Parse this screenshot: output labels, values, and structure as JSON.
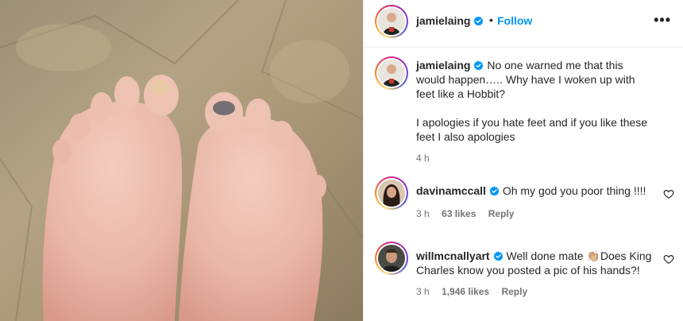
{
  "post": {
    "author": "jamielaing",
    "follow_label": "Follow",
    "separator": "•",
    "more_label": "•••"
  },
  "caption": {
    "author": "jamielaing",
    "line1": "No one warned me that this would happen….. Why have I woken up with feet like a Hobbit?",
    "line2": "I apologies if you hate feet and if you like these feet I also apologies",
    "time": "4 h"
  },
  "comments": [
    {
      "author": "davinamccall",
      "text": "Oh my god you poor thing !!!!",
      "time": "3 h",
      "likes": "63 likes",
      "reply_label": "Reply"
    },
    {
      "author": "willmcnallyart",
      "text_before": "Well done mate ",
      "emoji": "👏🏼",
      "text_after": "Does King Charles know you posted a pic of his hands?!",
      "time": "3 h",
      "likes": "1,946 likes",
      "reply_label": "Reply"
    }
  ],
  "colors": {
    "link_blue": "#0095f6",
    "verified_blue": "#0095f6",
    "meta_gray": "#737373",
    "divider": "#efefef"
  },
  "icons": [
    "verified-badge-icon",
    "more-options-icon",
    "heart-icon"
  ]
}
